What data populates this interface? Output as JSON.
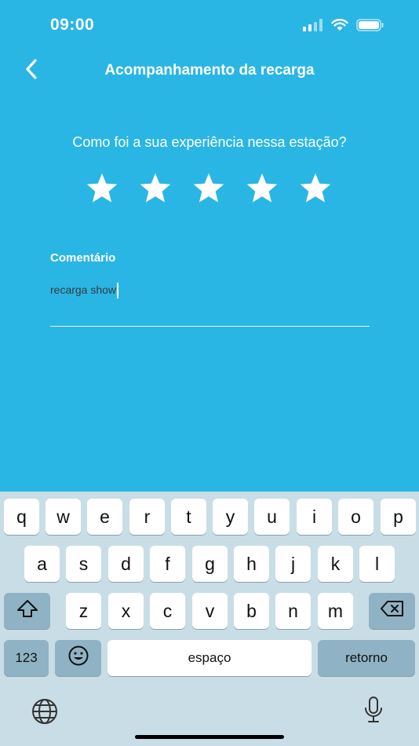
{
  "status_bar": {
    "time": "09:00"
  },
  "nav": {
    "title": "Acompanhamento da recarga"
  },
  "rating": {
    "question": "Como foi a sua experiência nessa estação?",
    "stars_total": 5,
    "stars_selected": 0
  },
  "comment": {
    "label": "Comentário",
    "value": "recarga show"
  },
  "keyboard": {
    "row1": [
      "q",
      "w",
      "e",
      "r",
      "t",
      "y",
      "u",
      "i",
      "o",
      "p"
    ],
    "row2": [
      "a",
      "s",
      "d",
      "f",
      "g",
      "h",
      "j",
      "k",
      "l"
    ],
    "row3": [
      "z",
      "x",
      "c",
      "v",
      "b",
      "n",
      "m"
    ],
    "numbers_label": "123",
    "space_label": "espaço",
    "return_label": "retorno"
  },
  "colors": {
    "background": "#29b6e4",
    "keyboard_background": "#c9dde6",
    "key_dark": "#8fb3c5"
  }
}
